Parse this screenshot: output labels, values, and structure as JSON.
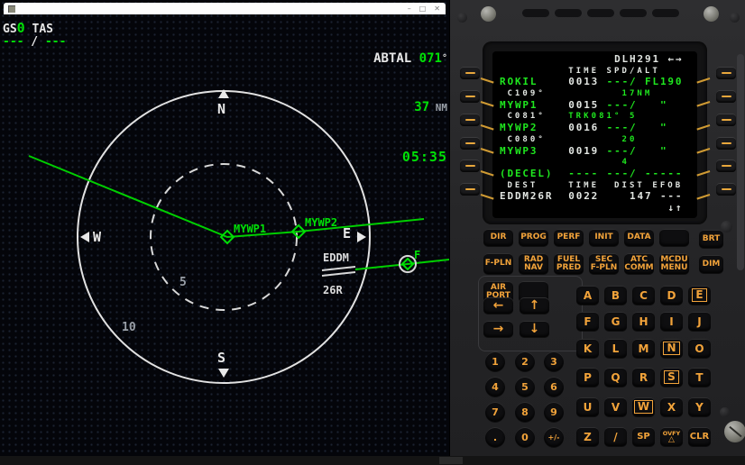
{
  "window": {
    "title": "",
    "minimize": "–",
    "maximize": "□",
    "close": "✕"
  },
  "nd": {
    "gs_label": "GS",
    "gs_value": "0",
    "tas_label": "TAS",
    "wind_left": "---",
    "wind_slash": " / ",
    "wind_right": "---",
    "next_waypoint": {
      "name": "ABTAL ",
      "bearing": "071",
      "degree": "°",
      "distance": "37",
      "distance_unit": " NM",
      "eta": "05:35"
    },
    "compass": {
      "north": "N",
      "south": "S",
      "east": "E",
      "west": "W"
    },
    "range_inner": "5",
    "range_outer": "10",
    "waypoint1": "MYWP1",
    "waypoint2": "MYWP2",
    "fix_label": "F",
    "airport_line1": "EDDM",
    "airport_line2": "26R",
    "colors": {
      "route_green": "#00cf00",
      "text_green": "#00e006",
      "white": "#e8e8e8"
    }
  },
  "mcdu": {
    "screen": {
      "rows": [
        {
          "cls": "t",
          "segs": [
            {
              "t": "               DLH291 ",
              "c": "w"
            },
            {
              "t": "←→",
              "c": "w"
            }
          ]
        },
        {
          "cls": "sm",
          "segs": [
            {
              "t": "         TIME SPD/ALT",
              "c": "w"
            }
          ]
        },
        {
          "cls": "lg",
          "segs": [
            {
              "t": "ROKIL",
              "c": "g"
            },
            {
              "t": "    ",
              "c": "w"
            },
            {
              "t": "0013 ",
              "c": "w"
            },
            {
              "t": "---/ FL190",
              "c": "g"
            }
          ]
        },
        {
          "cls": "sm",
          "segs": [
            {
              "t": " C109°",
              "c": "w"
            },
            {
              "t": "          ",
              "c": "w"
            },
            {
              "t": "17NM",
              "c": "g"
            }
          ]
        },
        {
          "cls": "lg",
          "segs": [
            {
              "t": "MYWP1",
              "c": "g"
            },
            {
              "t": "    ",
              "c": "w"
            },
            {
              "t": "0015 ",
              "c": "w"
            },
            {
              "t": "---/",
              "c": "g"
            },
            {
              "t": "   ",
              "c": "w"
            },
            {
              "t": "\"",
              "c": "g"
            }
          ]
        },
        {
          "cls": "sm",
          "segs": [
            {
              "t": " C081°",
              "c": "w"
            },
            {
              "t": "   ",
              "c": "w"
            },
            {
              "t": "TRK081° 5",
              "c": "g"
            }
          ]
        },
        {
          "cls": "lg",
          "segs": [
            {
              "t": "MYWP2",
              "c": "g"
            },
            {
              "t": "    ",
              "c": "w"
            },
            {
              "t": "0016 ",
              "c": "w"
            },
            {
              "t": "---/",
              "c": "g"
            },
            {
              "t": "   ",
              "c": "w"
            },
            {
              "t": "\"",
              "c": "g"
            }
          ]
        },
        {
          "cls": "sm",
          "segs": [
            {
              "t": " C080°",
              "c": "w"
            },
            {
              "t": "          ",
              "c": "w"
            },
            {
              "t": "20",
              "c": "g"
            }
          ]
        },
        {
          "cls": "lg",
          "segs": [
            {
              "t": "MYWP3",
              "c": "g"
            },
            {
              "t": "    ",
              "c": "w"
            },
            {
              "t": "0019 ",
              "c": "w"
            },
            {
              "t": "---/",
              "c": "g"
            },
            {
              "t": "   ",
              "c": "w"
            },
            {
              "t": "\"",
              "c": "g"
            }
          ]
        },
        {
          "cls": "sm",
          "segs": [
            {
              "t": "                ",
              "c": "w"
            },
            {
              "t": "4",
              "c": "g"
            }
          ]
        },
        {
          "cls": "lg",
          "segs": [
            {
              "t": "(DECEL)",
              "c": "g"
            },
            {
              "t": "  ",
              "c": "w"
            },
            {
              "t": "---- ---/ -----",
              "c": "g"
            }
          ]
        },
        {
          "cls": "sm",
          "segs": [
            {
              "t": " DEST    TIME  DIST EFOB",
              "c": "w"
            }
          ]
        },
        {
          "cls": "lg",
          "segs": [
            {
              "t": "EDDM26R",
              "c": "w"
            },
            {
              "t": "  ",
              "c": "w"
            },
            {
              "t": "0022",
              "c": "w"
            },
            {
              "t": "    ",
              "c": "w"
            },
            {
              "t": "147",
              "c": "w"
            },
            {
              "t": " ",
              "c": "w"
            },
            {
              "t": "---",
              "c": "w"
            }
          ]
        },
        {
          "cls": "lg",
          "segs": [
            {
              "t": "                      ",
              "c": "w"
            },
            {
              "t": "↓↑",
              "c": "w"
            }
          ]
        }
      ]
    },
    "function_keys_row1": [
      "DIR",
      "PROG",
      "PERF",
      "INIT",
      "DATA",
      ""
    ],
    "function_keys_row2": [
      "F-PLN",
      "RAD\nNAV",
      "FUEL\nPRED",
      "SEC\nF-PLN",
      "ATC\nCOMM",
      "MCDU\nMENU"
    ],
    "function_keys_row3": [
      "AIR\nPORT",
      ""
    ],
    "brightness_keys": [
      "BRT",
      "DIM"
    ],
    "slew_keys": {
      "left": "←",
      "up": "↑",
      "right": "→",
      "down": "↓"
    },
    "numpad": [
      "1",
      "2",
      "3",
      "4",
      "5",
      "6",
      "7",
      "8",
      "9",
      ".",
      "0",
      "+/-"
    ],
    "letter_rows": [
      [
        "A",
        "B",
        "C",
        "D",
        "E"
      ],
      [
        "F",
        "G",
        "H",
        "I",
        "J"
      ],
      [
        "K",
        "L",
        "M",
        "N",
        "O"
      ],
      [
        "P",
        "Q",
        "R",
        "S",
        "T"
      ],
      [
        "U",
        "V",
        "W",
        "X",
        "Y"
      ],
      [
        "Z",
        "/",
        "SP",
        "OVFY",
        "CLR"
      ]
    ],
    "boxed_keys": [
      "E",
      "N",
      "S",
      "W"
    ],
    "ovfy_symbol": "△",
    "colors": {
      "amber": "#f2a33a",
      "screen_green": "#1fe81f",
      "screen_white": "#e2e6e2"
    }
  }
}
